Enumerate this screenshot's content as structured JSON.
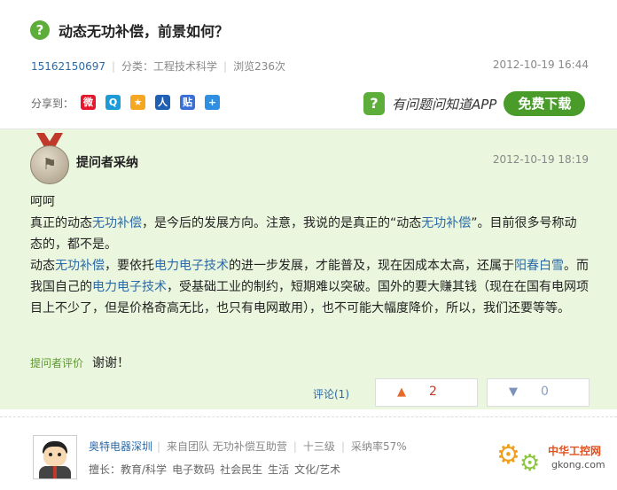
{
  "question": {
    "title": "动态无功补偿，前景如何？",
    "icon": "?",
    "user": "15162150697",
    "category": "分类：工程技术科学",
    "views": "浏览236次",
    "time": "2012-10-19 16:44"
  },
  "share": {
    "label": "分享到：",
    "icons": [
      "weibo-icon",
      "qzone-icon",
      "tencent-weibo-icon",
      "renren-icon",
      "tieba-icon",
      "more-share-icon"
    ]
  },
  "app_promo": {
    "text": "有问题问知道APP",
    "button": "免费下载",
    "icon": "?"
  },
  "answer": {
    "adopt_label": "提问者采纳",
    "time": "2012-10-19 18:19",
    "lines": {
      "l1": "呵呵",
      "l2a": " 真正的动态",
      "l2b": "无功补偿",
      "l2c": "，是今后的发展方向。注意，我说的是真正的“动态",
      "l2d": "无功补偿",
      "l2e": "”。目前很多号称动态的，都不是。",
      "l3a": " 动态",
      "l3b": "无功补偿",
      "l3c": "，要依托",
      "l3d": "电力电子技术",
      "l3e": "的进一步发展，才能普及，现在因成本太高，还属于",
      "l3f": "阳春白雪",
      "l3g": "。而我国自己的",
      "l3h": "电力电子技术",
      "l3i": "，受基础工业的制约，短期难以突破。国外的要大赚其钱（现在在国有电网项目上不少了，但是价格奇高无比，也只有电网敢用），也不可能大幅度降价，所以，我们还要等等。"
    },
    "eval_label": "提问者评价",
    "eval_text": "谢谢！",
    "comments": "评论(1)",
    "up_count": "2",
    "down_count": "0"
  },
  "answerer": {
    "name": "奥特电器深圳",
    "team": "来自团队 无功补偿互助营",
    "level": "十三级",
    "rate": "采纳率57%",
    "expertise_label": "擅长：",
    "tags": [
      "教育/科学",
      "电子数码",
      "社会民生",
      "生活",
      "文化/艺术"
    ]
  },
  "watermark": {
    "line1": "中华工控网",
    "line2": "gkong.com"
  }
}
